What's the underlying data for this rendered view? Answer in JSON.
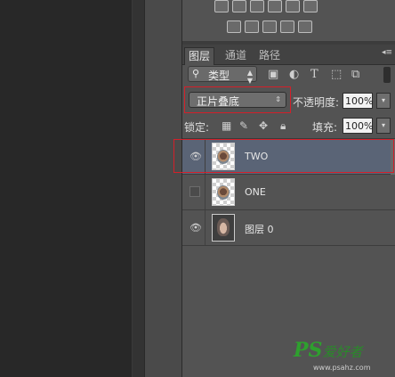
{
  "tabs": [
    {
      "label": "图层",
      "active": true
    },
    {
      "label": "通道",
      "active": false
    },
    {
      "label": "路径",
      "active": false
    }
  ],
  "filter": {
    "label": "类型"
  },
  "blend": {
    "mode": "正片叠底"
  },
  "opacity": {
    "label": "不透明度:",
    "value": "100%"
  },
  "lock": {
    "label": "锁定:"
  },
  "fill": {
    "label": "填充:",
    "value": "100%"
  },
  "layers": [
    {
      "name": "TWO",
      "visible": true,
      "selected": true
    },
    {
      "name": "ONE",
      "visible": false,
      "selected": false
    },
    {
      "name": "图层 0",
      "visible": true,
      "selected": false
    }
  ],
  "watermark": {
    "logo": "PS",
    "text": "爱好者",
    "url": "www.psahz.com"
  },
  "colors": {
    "accent": "#d3202a",
    "panel": "#535353",
    "selected_row": "#5a6476"
  }
}
